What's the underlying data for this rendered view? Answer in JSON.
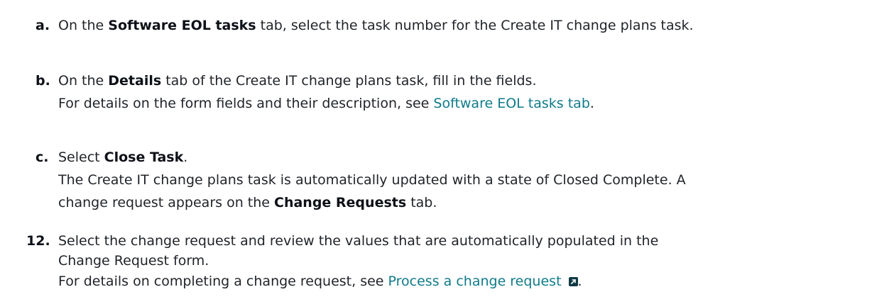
{
  "step_a": {
    "marker": "a.",
    "before": "On the ",
    "bold": "Software EOL tasks",
    "after": " tab, select the task number for the Create IT change plans task."
  },
  "step_b": {
    "marker": "b.",
    "before": "On the ",
    "bold": "Details",
    "after": " tab of the Create IT change plans task, fill in the fields.",
    "line2_before": "For details on the form fields and their description, see ",
    "line2_link": "Software EOL tasks tab",
    "line2_after": "."
  },
  "step_c": {
    "marker": "c.",
    "before": "Select ",
    "bold": "Close Task",
    "after": ".",
    "line2": "The Create IT change plans task is automatically updated with a state of Closed Complete. A",
    "line3_before": "change request appears on the ",
    "line3_bold": "Change Requests",
    "line3_after": " tab."
  },
  "step_12": {
    "marker": "12.",
    "line1": "Select the change request and review the values that are automatically populated in the",
    "line2": "Change Request form.",
    "line3_before": "For details on completing a change request, see ",
    "line3_link": "Process a change request",
    "line3_after": ".",
    "external_icon": "external-link-icon"
  },
  "colors": {
    "text": "#1f2328",
    "link": "#0f7b8a",
    "icon_bg": "#0f3a44"
  }
}
